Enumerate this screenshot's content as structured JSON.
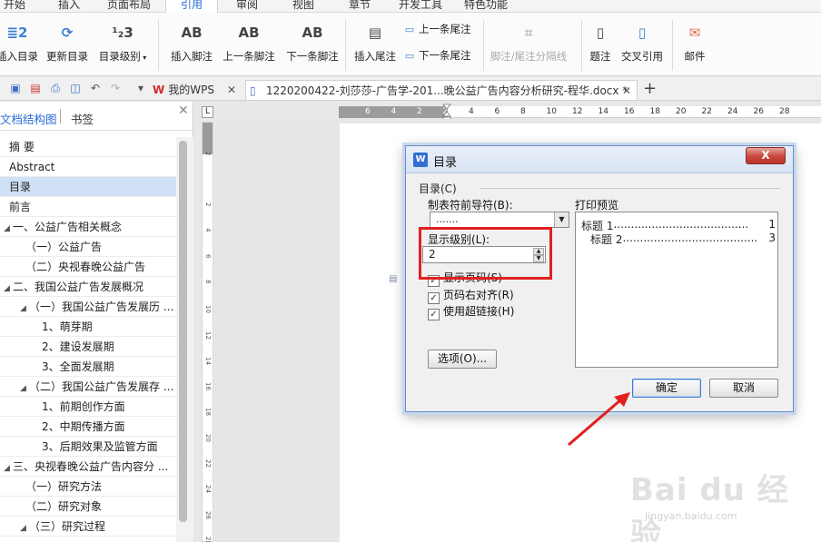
{
  "menu": {
    "tabs": [
      "开始",
      "插入",
      "页面布局",
      "引用",
      "审阅",
      "视图",
      "章节",
      "开发工具",
      "特色功能"
    ],
    "active": "引用"
  },
  "ribbon": {
    "insert_toc": "插入目录",
    "update_toc": "更新目录",
    "toc_level": "目录级别",
    "insert_footnote": "插入脚注",
    "prev_footnote": "上一条脚注",
    "next_footnote": "下一条脚注",
    "insert_endnote": "插入尾注",
    "prev_endnote": "上一条尾注",
    "next_endnote": "下一条尾注",
    "separator": "脚注/尾注分隔线",
    "caption": "题注",
    "cross_ref": "交叉引用",
    "mail": "邮件"
  },
  "tabs": {
    "wps": "我的WPS",
    "doc": "1220200422-刘莎莎-广告学-201...晚公益广告内容分析研究-程华.docx *"
  },
  "left_panel": {
    "tab1": "文档结构图",
    "tab2": "书签",
    "items": [
      {
        "text": "摘  要",
        "indent": 0,
        "tri": ""
      },
      {
        "text": "Abstract",
        "indent": 0,
        "tri": ""
      },
      {
        "text": "目录",
        "indent": 0,
        "tri": "",
        "selected": true
      },
      {
        "text": "前言",
        "indent": 0,
        "tri": ""
      },
      {
        "text": "一、公益广告相关概念",
        "indent": 0,
        "tri": "◢"
      },
      {
        "text": "（一）公益广告",
        "indent": 1,
        "tri": ""
      },
      {
        "text": "（二）央视春晚公益广告",
        "indent": 1,
        "tri": ""
      },
      {
        "text": "二、我国公益广告发展概况",
        "indent": 0,
        "tri": "◢"
      },
      {
        "text": "（一）我国公益广告发展历 ...",
        "indent": 1,
        "tri": "◢"
      },
      {
        "text": "1、萌芽期",
        "indent": 2,
        "tri": ""
      },
      {
        "text": "2、建设发展期",
        "indent": 2,
        "tri": ""
      },
      {
        "text": "3、全面发展期",
        "indent": 2,
        "tri": ""
      },
      {
        "text": "（二）我国公益广告发展存 ...",
        "indent": 1,
        "tri": "◢"
      },
      {
        "text": "1、前期创作方面",
        "indent": 2,
        "tri": ""
      },
      {
        "text": "2、中期传播方面",
        "indent": 2,
        "tri": ""
      },
      {
        "text": "3、后期效果及监管方面",
        "indent": 2,
        "tri": ""
      },
      {
        "text": "三、央视春晚公益广告内容分 ...",
        "indent": 0,
        "tri": "◢"
      },
      {
        "text": "（一）研究方法",
        "indent": 1,
        "tri": ""
      },
      {
        "text": "（二）研究对象",
        "indent": 1,
        "tri": ""
      },
      {
        "text": "（三）研究过程",
        "indent": 1,
        "tri": "◢"
      }
    ]
  },
  "hruler_nums": [
    "6",
    "4",
    "2",
    "2",
    "4",
    "6",
    "8",
    "10",
    "12",
    "14",
    "16",
    "18",
    "20",
    "22",
    "24",
    "26",
    "28"
  ],
  "vruler_nums": [
    "2",
    "2",
    "4",
    "6",
    "8",
    "10",
    "12",
    "14",
    "16",
    "18",
    "20",
    "22",
    "24",
    "26",
    "28"
  ],
  "dialog": {
    "title": "目录",
    "group": "目录(C)",
    "leader_label": "制表符前导符(B):",
    "leader_value": ".......",
    "level_label": "显示级别(L):",
    "level_value": "2",
    "show_page": "显示页码(S)",
    "align_right": "页码右对齐(R)",
    "hyperlink": "使用超链接(H)",
    "preview_label": "打印预览",
    "preview_rows": [
      {
        "title": "标题 1",
        "page": "1"
      },
      {
        "title": "标题 2",
        "page": "3"
      }
    ],
    "options": "选项(O)...",
    "ok": "确定",
    "cancel": "取消",
    "close": "X"
  },
  "watermark": {
    "big": "Bai du 经验",
    "small": "jingyan.baidu.com"
  }
}
